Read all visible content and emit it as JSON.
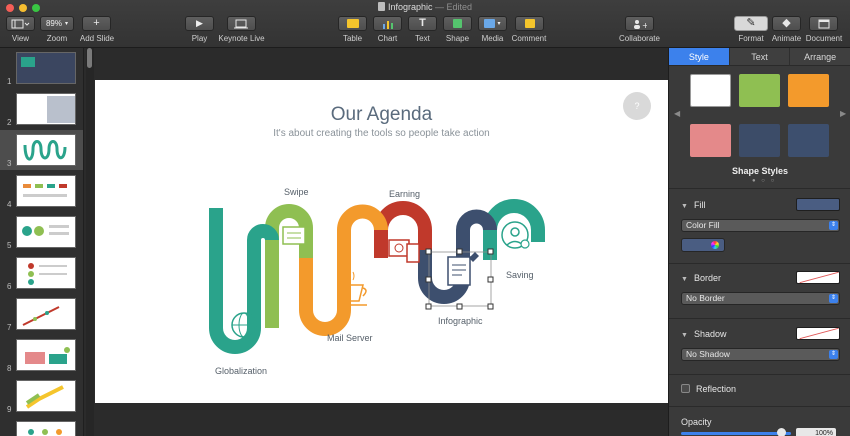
{
  "window": {
    "title": "Infographic",
    "status": "Edited",
    "separator": " — "
  },
  "toolbar": {
    "view": "View",
    "zoom": "Zoom",
    "zoom_value": "89%",
    "add_slide": "Add Slide",
    "play": "Play",
    "keynote_live": "Keynote Live",
    "table": "Table",
    "chart": "Chart",
    "text": "Text",
    "shape": "Shape",
    "media": "Media",
    "comment": "Comment",
    "collaborate": "Collaborate",
    "format": "Format",
    "animate": "Animate",
    "document": "Document"
  },
  "navigator": {
    "slides": [
      "1",
      "2",
      "3",
      "4",
      "5",
      "6",
      "7",
      "8",
      "9",
      "10"
    ],
    "selected": "3"
  },
  "slide": {
    "title": "Our Agenda",
    "subtitle": "It's about creating the tools so people take action",
    "labels": {
      "swipe": "Swipe",
      "earning": "Earning",
      "saving": "Saving",
      "infographic": "Infographic",
      "mail_server": "Mail Server",
      "globalization": "Globalization"
    },
    "colors": {
      "teal": "#2aa38b",
      "green": "#8fbf52",
      "orange": "#f39a2c",
      "red": "#c0392b",
      "navy": "#3d4f6e"
    }
  },
  "inspector": {
    "tabs": [
      "Style",
      "Text",
      "Arrange"
    ],
    "active_tab": "Style",
    "shape_styles_label": "Shape Styles",
    "fill": {
      "label": "Fill",
      "type": "Color Fill"
    },
    "border": {
      "label": "Border",
      "value": "No Border"
    },
    "shadow": {
      "label": "Shadow",
      "value": "No Shadow"
    },
    "reflection": {
      "label": "Reflection",
      "checked": false
    },
    "opacity": {
      "label": "Opacity",
      "value": "100%"
    }
  }
}
